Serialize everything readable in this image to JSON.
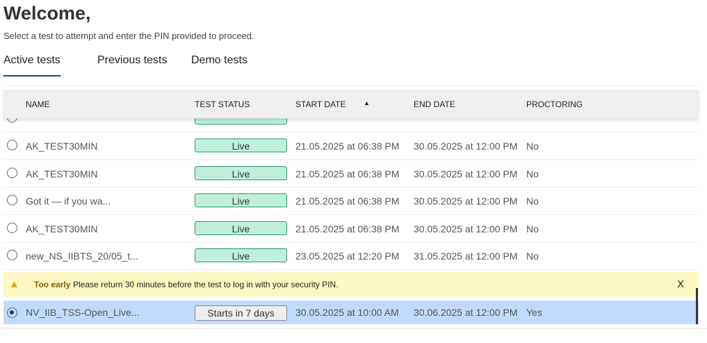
{
  "header": {
    "title": "Welcome,",
    "subtitle": "Select a test to attempt and enter the PIN provided to proceed."
  },
  "tabs": [
    {
      "label": "Active tests",
      "active": true
    },
    {
      "label": "Previous tests"
    },
    {
      "label": "Demo tests"
    }
  ],
  "table": {
    "columns": [
      "NAME",
      "TEST STATUS",
      "START DATE",
      "END DATE",
      "PROCTORING"
    ],
    "sort": {
      "column": "START DATE",
      "direction": "ascending"
    },
    "rows": [
      {
        "name": "AK_TEST30MIN",
        "status": "Live",
        "start": "21.05.2025 at 06:38 PM",
        "end": "30.05.2025 at 12:00 PM",
        "proctoring": "No"
      },
      {
        "name": "AK_TEST30MIN",
        "status": "Live",
        "start": "21.05.2025 at 06:38 PM",
        "end": "30.05.2025 at 12:00 PM",
        "proctoring": "No"
      },
      {
        "name": "Got it — if you wa...",
        "status": "Live",
        "start": "21.05.2025 at 06:38 PM",
        "end": "30.05.2025 at 12:00 PM",
        "proctoring": "No"
      },
      {
        "name": "AK_TEST30MIN",
        "status": "Live",
        "start": "21.05.2025 at 06:38 PM",
        "end": "30.05.2025 at 12:00 PM",
        "proctoring": "No"
      },
      {
        "name": "new_NS_IIBTS_20/05_t...",
        "status": "Live",
        "start": "23.05.2025 at 12:20 PM",
        "end": "31.05.2025 at 12:00 PM",
        "proctoring": "No"
      }
    ],
    "selected": {
      "name": "NV_IIB_TSS-Open_Live...",
      "status": "Starts in 7 days",
      "start": "30.05.2025 at 10:00 AM",
      "end": "30.06.2025 at 12:00 PM",
      "proctoring": "Yes"
    }
  },
  "warning": {
    "title": "Too early",
    "message": "Please return 30 minutes before the test to log in with your security PIN.",
    "close": "X"
  },
  "colors": {
    "live_bg": "#bff0dc",
    "live_border": "#2a9a6a",
    "warning_bg": "#fcf8c4",
    "selected_bg": "#c2dafc",
    "tab_underline": "#1f4f7a"
  }
}
